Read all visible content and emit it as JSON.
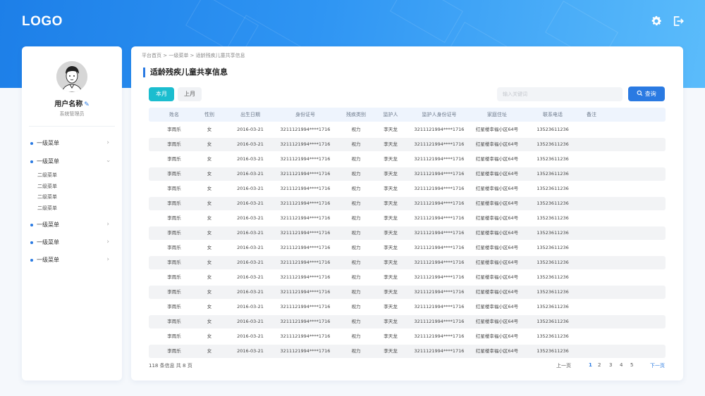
{
  "header": {
    "logo": "LOGO",
    "settings_icon": "gear-icon",
    "logout_icon": "logout-icon"
  },
  "colors": {
    "primary": "#2a7ae2",
    "tab_active": "#1bbdcf"
  },
  "user": {
    "name": "用户名称",
    "role": "系统管理员",
    "edit_icon": "pencil-icon"
  },
  "sidebar": {
    "items": [
      {
        "label": "一级菜单"
      },
      {
        "label": "一级菜单",
        "expanded": true,
        "children": [
          "二级菜单",
          "二级菜单",
          "二级菜单",
          "二级菜单"
        ]
      },
      {
        "label": "一级菜单"
      },
      {
        "label": "一级菜单"
      },
      {
        "label": "一级菜单"
      }
    ]
  },
  "breadcrumb": [
    "平台首页",
    "一级菜单",
    "适龄残疾儿童共享信息"
  ],
  "page_title": "适龄残疾儿童共享信息",
  "tabs": [
    {
      "label": "本月",
      "active": true
    },
    {
      "label": "上月",
      "active": false
    }
  ],
  "search": {
    "placeholder": "输入关键词",
    "button": "查询"
  },
  "table": {
    "columns": [
      "姓名",
      "性别",
      "出生日期",
      "身份证号",
      "残疾类别",
      "监护人",
      "监护人身份证号",
      "家庭住址",
      "联系电话",
      "备注"
    ],
    "rows": [
      [
        "李雨乐",
        "女",
        "2016-03-21",
        "3211121994****1716",
        "视力",
        "李天龙",
        "3211121994****1716",
        "红星楼幸福小区64号",
        "13523611236",
        ""
      ],
      [
        "李雨乐",
        "女",
        "2016-03-21",
        "3211121994****1716",
        "视力",
        "李天龙",
        "3211121994****1716",
        "红星楼幸福小区64号",
        "13523611236",
        ""
      ],
      [
        "李雨乐",
        "女",
        "2016-03-21",
        "3211121994****1716",
        "视力",
        "李天龙",
        "3211121994****1716",
        "红星楼幸福小区64号",
        "13523611236",
        ""
      ],
      [
        "李雨乐",
        "女",
        "2016-03-21",
        "3211121994****1716",
        "视力",
        "李天龙",
        "3211121994****1716",
        "红星楼幸福小区64号",
        "13523611236",
        ""
      ],
      [
        "李雨乐",
        "女",
        "2016-03-21",
        "3211121994****1716",
        "视力",
        "李天龙",
        "3211121994****1716",
        "红星楼幸福小区64号",
        "13523611236",
        ""
      ],
      [
        "李雨乐",
        "女",
        "2016-03-21",
        "3211121994****1716",
        "视力",
        "李天龙",
        "3211121994****1716",
        "红星楼幸福小区64号",
        "13523611236",
        ""
      ],
      [
        "李雨乐",
        "女",
        "2016-03-21",
        "3211121994****1716",
        "视力",
        "李天龙",
        "3211121994****1716",
        "红星楼幸福小区64号",
        "13523611236",
        ""
      ],
      [
        "李雨乐",
        "女",
        "2016-03-21",
        "3211121994****1716",
        "视力",
        "李天龙",
        "3211121994****1716",
        "红星楼幸福小区64号",
        "13523611236",
        ""
      ],
      [
        "李雨乐",
        "女",
        "2016-03-21",
        "3211121994****1716",
        "视力",
        "李天龙",
        "3211121994****1716",
        "红星楼幸福小区64号",
        "13523611236",
        ""
      ],
      [
        "李雨乐",
        "女",
        "2016-03-21",
        "3211121994****1716",
        "视力",
        "李天龙",
        "3211121994****1716",
        "红星楼幸福小区64号",
        "13523611236",
        ""
      ],
      [
        "李雨乐",
        "女",
        "2016-03-21",
        "3211121994****1716",
        "视力",
        "李天龙",
        "3211121994****1716",
        "红星楼幸福小区64号",
        "13523611236",
        ""
      ],
      [
        "李雨乐",
        "女",
        "2016-03-21",
        "3211121994****1716",
        "视力",
        "李天龙",
        "3211121994****1716",
        "红星楼幸福小区64号",
        "13523611236",
        ""
      ],
      [
        "李雨乐",
        "女",
        "2016-03-21",
        "3211121994****1716",
        "视力",
        "李天龙",
        "3211121994****1716",
        "红星楼幸福小区64号",
        "13523611236",
        ""
      ],
      [
        "李雨乐",
        "女",
        "2016-03-21",
        "3211121994****1716",
        "视力",
        "李天龙",
        "3211121994****1716",
        "红星楼幸福小区64号",
        "13523611236",
        ""
      ],
      [
        "李雨乐",
        "女",
        "2016-03-21",
        "3211121994****1716",
        "视力",
        "李天龙",
        "3211121994****1716",
        "红星楼幸福小区64号",
        "13523611236",
        ""
      ],
      [
        "李雨乐",
        "女",
        "2016-03-21",
        "3211121994****1716",
        "视力",
        "李天龙",
        "3211121994****1716",
        "红星楼幸福小区64号",
        "13523611236",
        ""
      ]
    ]
  },
  "footer": {
    "summary": "118 条信息 共 8 页",
    "prev": "上一页",
    "pages": [
      "1",
      "2",
      "3",
      "4",
      "5"
    ],
    "current_page": "1",
    "next": "下一页"
  }
}
